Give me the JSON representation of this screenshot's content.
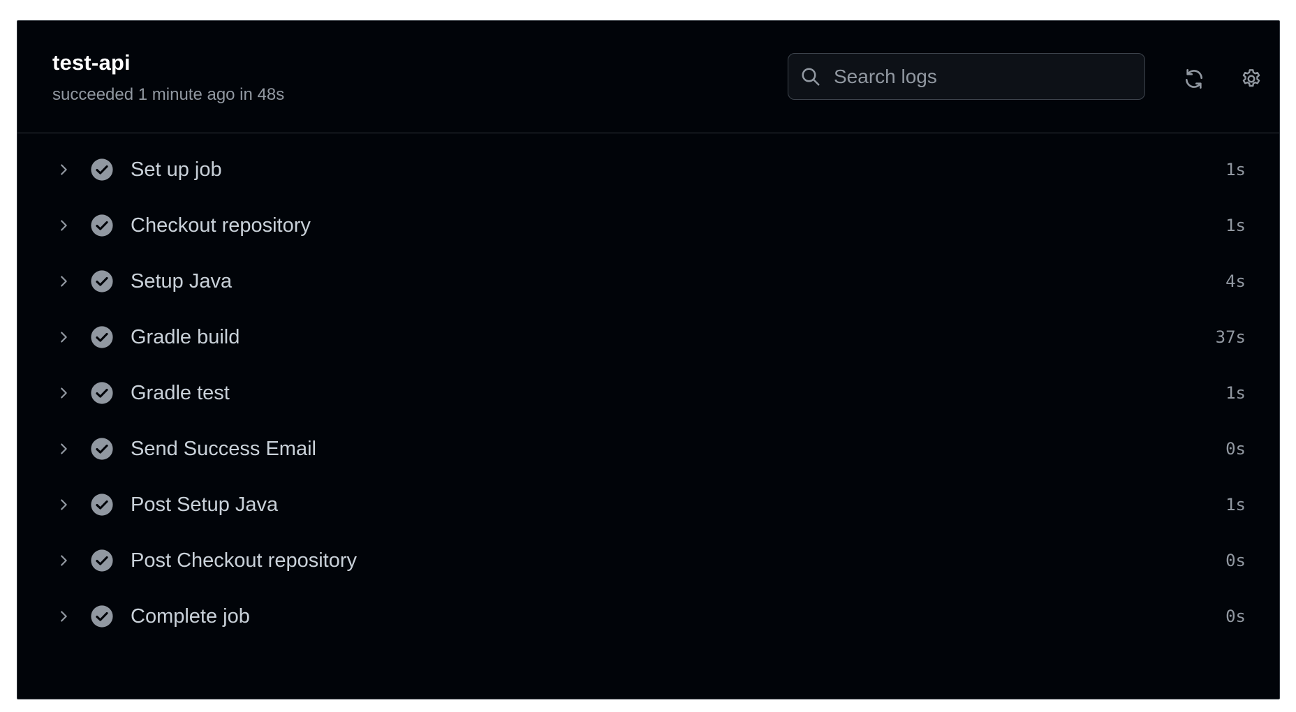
{
  "job": {
    "title": "test-api",
    "meta": "succeeded 1 minute ago in 48s"
  },
  "search": {
    "placeholder": "Search logs",
    "icon": "search-icon"
  },
  "toolbar": {
    "refresh_icon": "refresh-icon",
    "settings_icon": "gear-icon"
  },
  "steps": [
    {
      "name": "Set up job",
      "duration": "1s",
      "status": "success"
    },
    {
      "name": "Checkout repository",
      "duration": "1s",
      "status": "success"
    },
    {
      "name": "Setup Java",
      "duration": "4s",
      "status": "success"
    },
    {
      "name": "Gradle build",
      "duration": "37s",
      "status": "success"
    },
    {
      "name": "Gradle test",
      "duration": "1s",
      "status": "success"
    },
    {
      "name": "Send Success Email",
      "duration": "0s",
      "status": "success"
    },
    {
      "name": "Post Setup Java",
      "duration": "1s",
      "status": "success"
    },
    {
      "name": "Post Checkout repository",
      "duration": "0s",
      "status": "success"
    },
    {
      "name": "Complete job",
      "duration": "0s",
      "status": "success"
    }
  ],
  "colors": {
    "background": "#010409",
    "border": "#30363d",
    "status_success": "#9198a1",
    "text_primary": "#ffffff",
    "text_muted": "#9198a1"
  }
}
